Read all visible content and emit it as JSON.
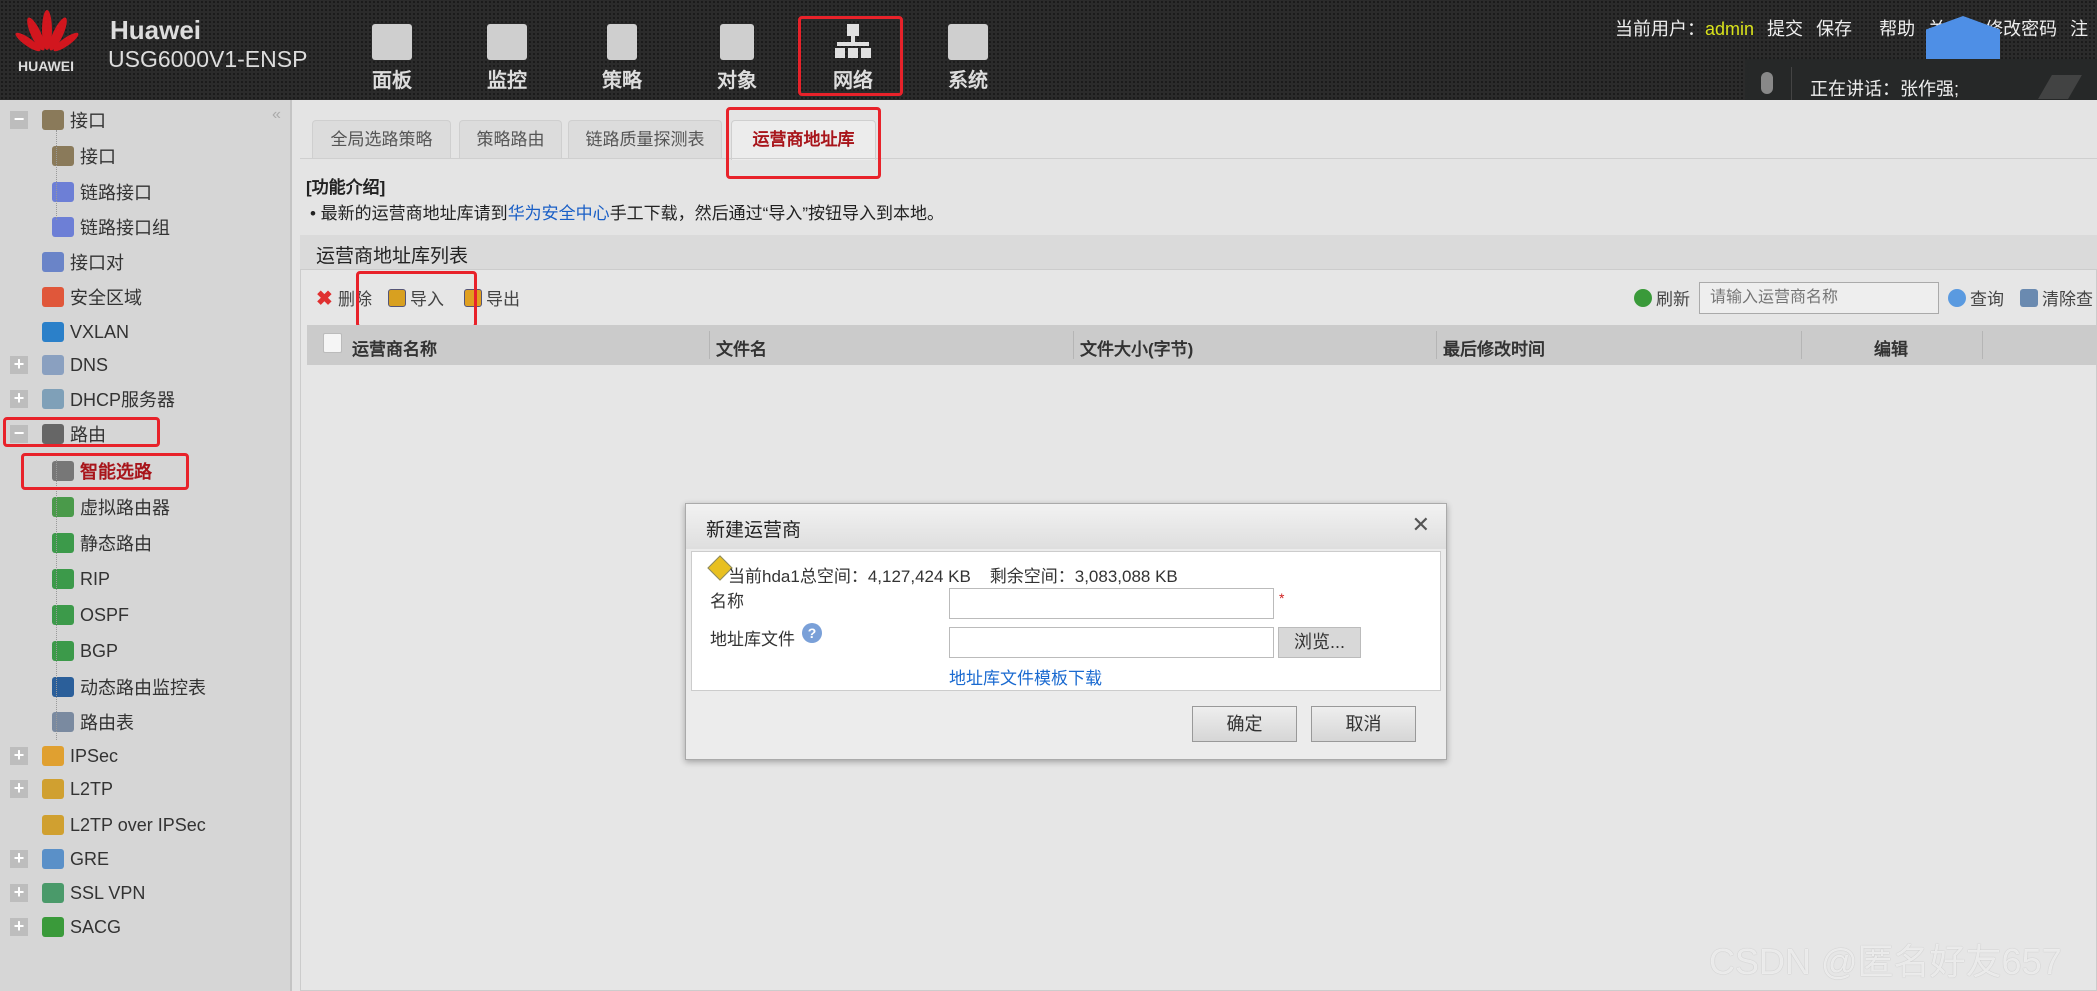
{
  "header": {
    "logo_text": "HUAWEI",
    "brand": "Huawei",
    "model": "USG6000V1-ENSP",
    "nav": [
      {
        "label": "面板",
        "icon": "dashboard-icon"
      },
      {
        "label": "监控",
        "icon": "monitor-icon"
      },
      {
        "label": "策略",
        "icon": "policy-icon"
      },
      {
        "label": "对象",
        "icon": "object-icon"
      },
      {
        "label": "网络",
        "icon": "network-icon",
        "active": true
      },
      {
        "label": "系统",
        "icon": "system-icon"
      }
    ],
    "user_label": "当前用户：",
    "user": "admin",
    "links": [
      "提交",
      "保存",
      "帮助",
      "关",
      "修改密码",
      "注"
    ]
  },
  "notification": {
    "text": "正在讲话：张作强;"
  },
  "sidebar": {
    "items": [
      {
        "label": "接口",
        "level": 0,
        "expander": "-",
        "color": "#8a7a5a"
      },
      {
        "label": "接口",
        "level": 1,
        "color": "#8a7a5a"
      },
      {
        "label": "链路接口",
        "level": 1,
        "color": "#6d7fd6"
      },
      {
        "label": "链路接口组",
        "level": 1,
        "color": "#6d7fd6"
      },
      {
        "label": "接口对",
        "level": 0,
        "color": "#6a84c8"
      },
      {
        "label": "安全区域",
        "level": 0,
        "color": "#e0573a"
      },
      {
        "label": "VXLAN",
        "level": 0,
        "color": "#2b80c9"
      },
      {
        "label": "DNS",
        "level": 0,
        "expander": "+",
        "color": "#8aa0c0"
      },
      {
        "label": "DHCP服务器",
        "level": 0,
        "expander": "+",
        "color": "#7fa0b8"
      },
      {
        "label": "路由",
        "level": 0,
        "expander": "-",
        "color": "#666"
      },
      {
        "label": "智能选路",
        "level": 1,
        "color": "#777",
        "active": true
      },
      {
        "label": "虚拟路由器",
        "level": 1,
        "color": "#4a9a4a"
      },
      {
        "label": "静态路由",
        "level": 1,
        "color": "#3c9a4a"
      },
      {
        "label": "RIP",
        "level": 1,
        "color": "#3c9a4a"
      },
      {
        "label": "OSPF",
        "level": 1,
        "color": "#3c9a4a"
      },
      {
        "label": "BGP",
        "level": 1,
        "color": "#3c9a4a"
      },
      {
        "label": "动态路由监控表",
        "level": 1,
        "color": "#2b5f9a"
      },
      {
        "label": "路由表",
        "level": 1,
        "color": "#7a8aa0"
      },
      {
        "label": "IPSec",
        "level": 0,
        "expander": "+",
        "color": "#e0a030"
      },
      {
        "label": "L2TP",
        "level": 0,
        "expander": "+",
        "color": "#d0a030"
      },
      {
        "label": "L2TP over IPSec",
        "level": 0,
        "color": "#d0a030"
      },
      {
        "label": "GRE",
        "level": 0,
        "expander": "+",
        "color": "#5a90c8"
      },
      {
        "label": "SSL VPN",
        "level": 0,
        "expander": "+",
        "color": "#4a9a6a"
      },
      {
        "label": "SACG",
        "level": 0,
        "expander": "+",
        "color": "#3a9a3a"
      }
    ]
  },
  "tabs": [
    "全局选路策略",
    "策略路由",
    "链路质量探测表",
    "运营商地址库"
  ],
  "intro": {
    "title": "[功能介绍]",
    "prefix": "• 最新的运营商地址库请到",
    "link": "华为安全中心",
    "suffix": "手工下载，然后通过“导入”按钮导入到本地。"
  },
  "panel": {
    "title": "运营商地址库列表",
    "toolbar": {
      "delete": "删除",
      "import": "导入",
      "export": "导出",
      "refresh": "刷新",
      "search_placeholder": "请输入运营商名称",
      "query": "查询",
      "clear": "清除查"
    },
    "columns": [
      "运营商名称",
      "文件名",
      "文件大小(字节)",
      "最后修改时间",
      "编辑"
    ]
  },
  "dialog": {
    "title": "新建运营商",
    "space_info": "当前hda1总空间：4,127,424 KB    剩余空间：3,083,088 KB",
    "name_label": "名称",
    "name_value": "",
    "required": "*",
    "file_label": "地址库文件",
    "file_value": "",
    "browse": "浏览...",
    "template_link": "地址库文件模板下载",
    "ok": "确定",
    "cancel": "取消"
  },
  "watermark": "CSDN @匿名好友657"
}
